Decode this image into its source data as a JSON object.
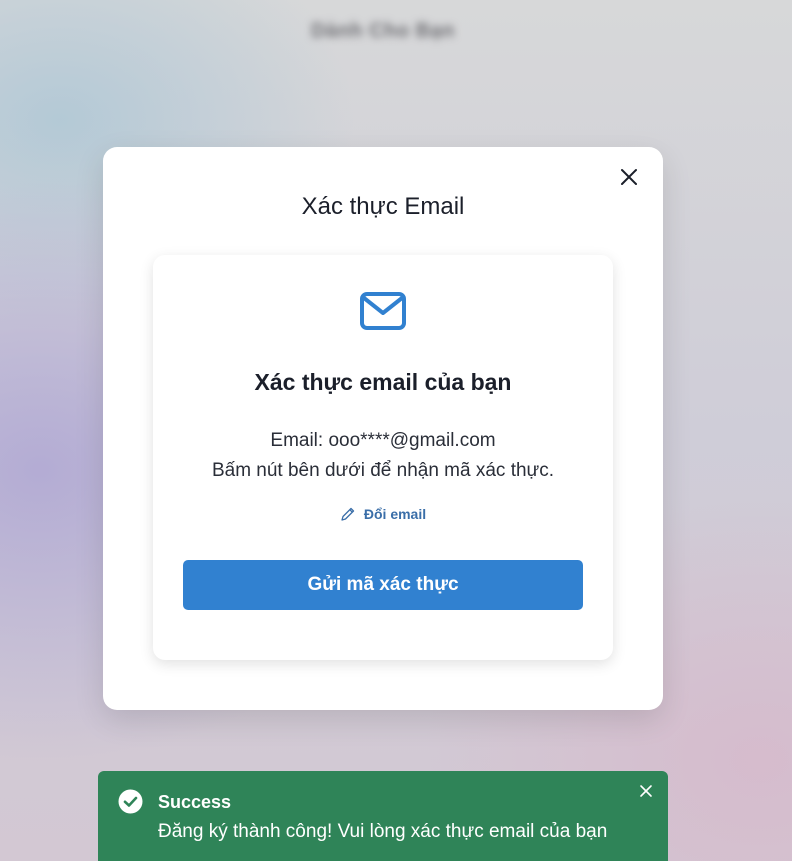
{
  "background": {
    "title": "Dành Cho Bạn"
  },
  "modal": {
    "title": "Xác thực Email",
    "close_icon": "close-icon"
  },
  "card": {
    "icon": "mail-icon",
    "heading": "Xác thực email của bạn",
    "email_line": "Email: ooo****@gmail.com",
    "instruction": "Bấm nút bên dưới để nhận mã xác thực.",
    "change_email_label": "Đổi email",
    "send_button_label": "Gửi mã xác thực"
  },
  "toast": {
    "title": "Success",
    "message": "Đăng ký thành công! Vui lòng xác thực email của bạn",
    "icon": "check-circle-icon",
    "color": "#2f8458"
  },
  "colors": {
    "primary_button": "#3181d0",
    "link": "#3a6ea8",
    "icon": "#3181d0"
  }
}
